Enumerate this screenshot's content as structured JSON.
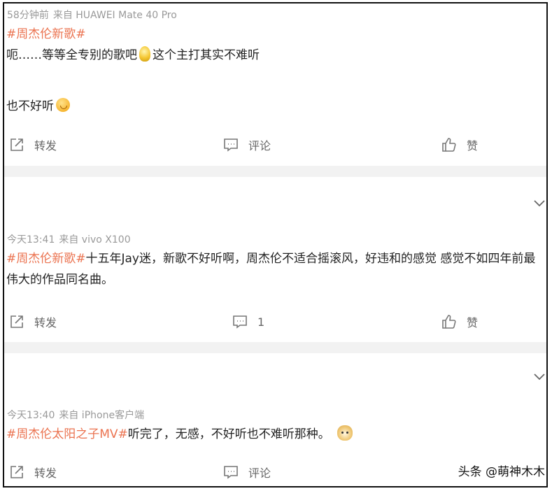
{
  "posts": [
    {
      "time": "58分钟前",
      "source": "来自 HUAWEI Mate 40 Pro",
      "topic": "#周杰伦新歌#",
      "line1_a": "呃……等等全专别的歌吧",
      "line1_b": "这个主打其实不难听",
      "line2": "也不好听",
      "actions": {
        "repost": "转发",
        "comment": "评论",
        "like": "赞"
      }
    },
    {
      "time": "今天13:41",
      "source": "来自 vivo X100",
      "topic": "#周杰伦新歌#",
      "text": "十五年Jay迷，新歌不好听啊，周杰伦不适合摇滚风，好违和的感觉 感觉不如四年前最伟大的作品同名曲。",
      "actions": {
        "repost": "转发",
        "comment": "1",
        "like": "赞"
      }
    },
    {
      "time": "今天13:40",
      "source": "来自 iPhone客户端",
      "topic": "#周杰伦太阳之子MV#",
      "text": "听完了，无感，不好听也不难听那种。",
      "actions": {
        "repost": "转发",
        "comment": "评论"
      }
    }
  ],
  "icons": {
    "repost": "share-icon",
    "comment": "comment-icon",
    "like": "thumbs-up-icon",
    "expand": "chevron-down-icon",
    "emoji1": "lightbulb-emoji-icon",
    "emoji2": "upside-down-face-emoji-icon",
    "emoji3": "doge-emoji-icon"
  },
  "colors": {
    "topic": "#eb7350",
    "meta": "#999999",
    "separator": "#f2f2f2"
  },
  "watermark": "头条 @萌神木木"
}
